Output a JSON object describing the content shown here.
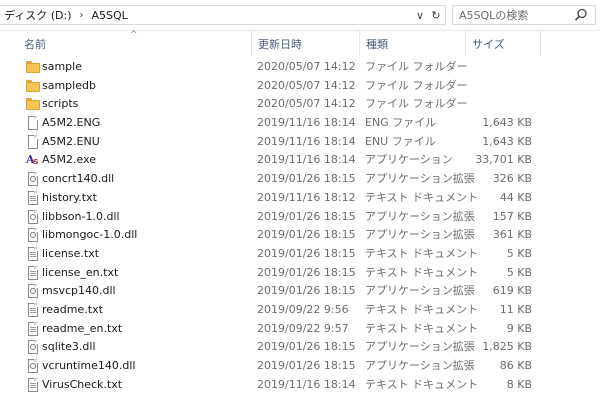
{
  "address_bar": {
    "crumbs": [
      "ディスク (D:)",
      "A5SQL"
    ],
    "separator": "›",
    "dropdown_glyph": "∨",
    "refresh_glyph": "↻"
  },
  "search": {
    "placeholder": "A5SQLの検索"
  },
  "columns": {
    "name": "名前",
    "date": "更新日時",
    "type": "種類",
    "size": "サイズ",
    "sort_glyph": "^"
  },
  "files": [
    {
      "icon": "folder-icon",
      "name": "sample",
      "date": "2020/05/07 14:12",
      "type": "ファイル フォルダー",
      "size": ""
    },
    {
      "icon": "folder-icon",
      "name": "sampledb",
      "date": "2020/05/07 14:12",
      "type": "ファイル フォルダー",
      "size": ""
    },
    {
      "icon": "folder-icon",
      "name": "scripts",
      "date": "2020/05/07 14:12",
      "type": "ファイル フォルダー",
      "size": ""
    },
    {
      "icon": "file-icon",
      "name": "A5M2.ENG",
      "date": "2019/11/16 18:14",
      "type": "ENG ファイル",
      "size": "1,643 KB"
    },
    {
      "icon": "file-icon",
      "name": "A5M2.ENU",
      "date": "2019/11/16 18:14",
      "type": "ENU ファイル",
      "size": "1,643 KB"
    },
    {
      "icon": "a5m2-app-icon",
      "name": "A5M2.exe",
      "date": "2019/11/16 18:14",
      "type": "アプリケーション",
      "size": "33,701 KB"
    },
    {
      "icon": "dll-file-icon",
      "name": "concrt140.dll",
      "date": "2019/01/26 18:15",
      "type": "アプリケーション拡張",
      "size": "326 KB"
    },
    {
      "icon": "text-file-icon",
      "name": "history.txt",
      "date": "2019/11/16 18:12",
      "type": "テキスト ドキュメント",
      "size": "44 KB"
    },
    {
      "icon": "dll-file-icon",
      "name": "libbson-1.0.dll",
      "date": "2019/01/26 18:15",
      "type": "アプリケーション拡張",
      "size": "157 KB"
    },
    {
      "icon": "dll-file-icon",
      "name": "libmongoc-1.0.dll",
      "date": "2019/01/26 18:15",
      "type": "アプリケーション拡張",
      "size": "361 KB"
    },
    {
      "icon": "text-file-icon",
      "name": "license.txt",
      "date": "2019/01/26 18:15",
      "type": "テキスト ドキュメント",
      "size": "5 KB"
    },
    {
      "icon": "text-file-icon",
      "name": "license_en.txt",
      "date": "2019/01/26 18:15",
      "type": "テキスト ドキュメント",
      "size": "5 KB"
    },
    {
      "icon": "dll-file-icon",
      "name": "msvcp140.dll",
      "date": "2019/01/26 18:15",
      "type": "アプリケーション拡張",
      "size": "619 KB"
    },
    {
      "icon": "text-file-icon",
      "name": "readme.txt",
      "date": "2019/09/22 9:56",
      "type": "テキスト ドキュメント",
      "size": "11 KB"
    },
    {
      "icon": "text-file-icon",
      "name": "readme_en.txt",
      "date": "2019/09/22 9:57",
      "type": "テキスト ドキュメント",
      "size": "9 KB"
    },
    {
      "icon": "dll-file-icon",
      "name": "sqlite3.dll",
      "date": "2019/01/26 18:15",
      "type": "アプリケーション拡張",
      "size": "1,825 KB"
    },
    {
      "icon": "dll-file-icon",
      "name": "vcruntime140.dll",
      "date": "2019/01/26 18:15",
      "type": "アプリケーション拡張",
      "size": "86 KB"
    },
    {
      "icon": "text-file-icon",
      "name": "VirusCheck.txt",
      "date": "2019/11/16 18:14",
      "type": "テキスト ドキュメント",
      "size": "8 KB"
    }
  ],
  "colors": {
    "header_text": "#4c607a",
    "meta_text": "#6d6d6d",
    "folder_yellow": "#f4c553"
  }
}
